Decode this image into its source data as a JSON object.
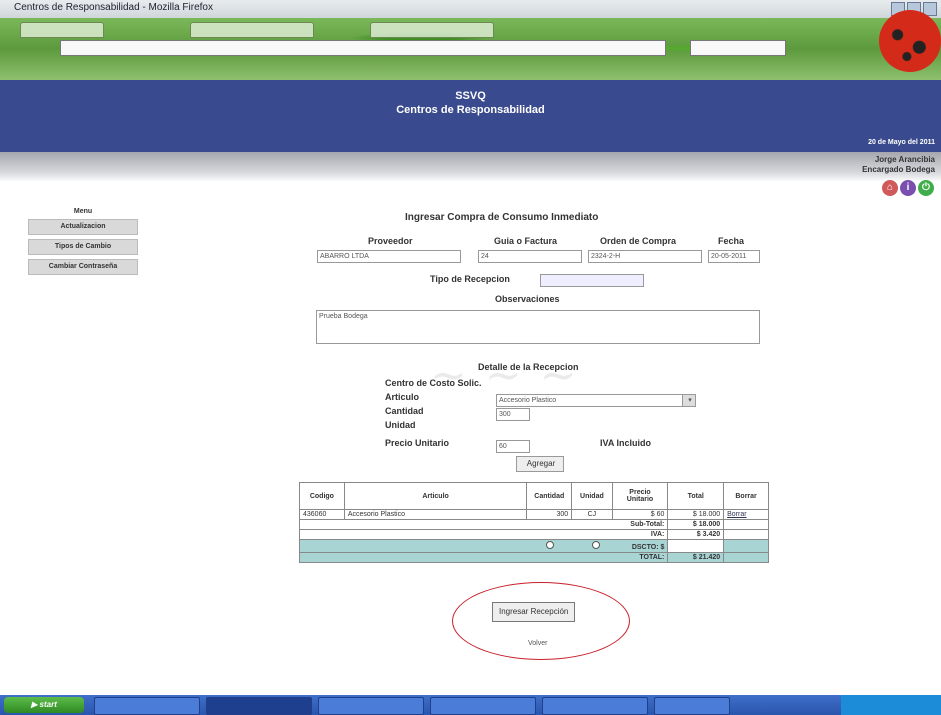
{
  "window": {
    "title": "Centros de Responsabilidad - Mozilla Firefox"
  },
  "browser": {
    "tabs": [
      "",
      "",
      ""
    ],
    "url": "",
    "search": ""
  },
  "header": {
    "app_name": "SSVQ",
    "subtitle": "Centros de Responsabilidad",
    "date": "20 de Mayo del 2011",
    "user_name": "Jorge Arancibia",
    "user_role": "Encargado Bodega"
  },
  "menu": {
    "title": "Menu",
    "items": [
      "Actualizacion",
      "Tipos de Cambio",
      "Cambiar Contraseña"
    ]
  },
  "form": {
    "title": "Ingresar Compra de Consumo Inmediato",
    "proveedor_label": "Proveedor",
    "proveedor_value": "ABARRO LTDA",
    "guia_label": "Guia o Factura",
    "guia_value": "24",
    "orden_label": "Orden de Compra",
    "orden_value": "2324-2-H",
    "fecha_label": "Fecha",
    "fecha_value": "20-05-2011",
    "tipo_label": "Tipo de Recepcion",
    "observaciones_label": "Observaciones",
    "observaciones_value": "Prueba Bodega"
  },
  "detalle": {
    "title": "Detalle de la Recepcion",
    "centro_label": "Centro de Costo Solic.",
    "articulo_label": "Articulo",
    "articulo_value": "Accesorio Plastico",
    "cantidad_label": "Cantidad",
    "cantidad_value": "300",
    "unidad_label": "Unidad",
    "precio_label": "Precio Unitario",
    "precio_value": "60",
    "iva_label": "IVA Incluido",
    "agregar_label": "Agregar"
  },
  "table": {
    "headers": [
      "Codigo",
      "Articulo",
      "Cantidad",
      "Unidad",
      "Precio Unitario",
      "Total",
      "Borrar"
    ],
    "rows": [
      [
        "436060",
        "Accesorio Plastico",
        "300",
        "CJ",
        "$ 60",
        "$ 18.000",
        "Borrar"
      ]
    ],
    "subtotal_label": "Sub-Total:",
    "subtotal_value": "$ 18.000",
    "iva_label": "IVA:",
    "iva_value": "$ 3.420",
    "dscto_label": "DSCTO: $",
    "total_label": "TOTAL:",
    "total_value": "$ 21.420"
  },
  "actions": {
    "ingresar_label": "Ingresar Recepción",
    "volver_label": "Volver"
  },
  "accent_colors": {
    "banner": "#3a4a8e",
    "teal_row": "#a9d4d4",
    "highlight_ellipse": "#c8202a"
  }
}
